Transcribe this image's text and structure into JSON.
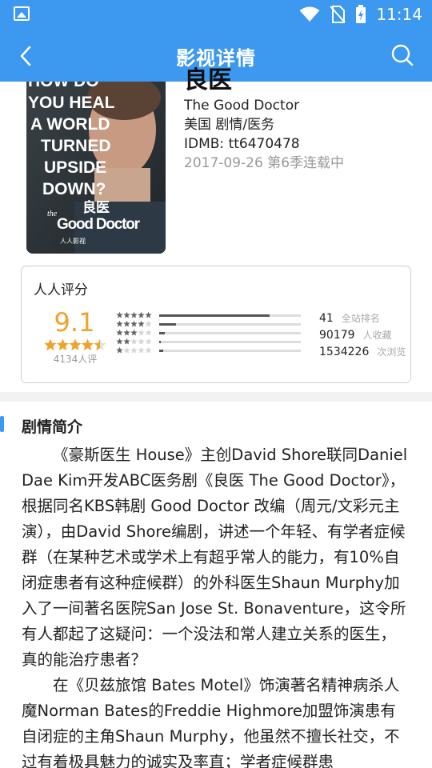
{
  "status_bar": {
    "time": "11:14"
  },
  "app_bar": {
    "title": "影视详情"
  },
  "poster": {
    "text_lines": [
      "HOW DO",
      "YOU HEAL",
      "A WORLD",
      "TURNED",
      "UPSIDE",
      "DOWN?"
    ],
    "title_cn": "良医",
    "title_en_the": "the",
    "title_en": "Good Doctor",
    "brand": "人人影视"
  },
  "show": {
    "name_cn": "良医",
    "name_en": "The Good Doctor",
    "region_genre": "美国 剧情/医务",
    "imdb": "IDMB: tt6470478",
    "date_status": "2017-09-26 第6季连载中"
  },
  "rating": {
    "label": "人人评分",
    "score": "9.1",
    "stars": 4.5,
    "count": "4134人评",
    "distribution": [
      0.78,
      0.12,
      0.04,
      0.01,
      0.03
    ],
    "stats": [
      {
        "value": "41",
        "label": "全站排名"
      },
      {
        "value": "90179",
        "label": "人收藏"
      },
      {
        "value": "1534226",
        "label": "次浏览"
      }
    ],
    "colors": {
      "accent": "#f0a329",
      "bar_fill": "#555555",
      "bar_track": "#dddddd"
    }
  },
  "synopsis": {
    "title": "剧情简介",
    "paragraphs": [
      "《豪斯医生 House》主创David Shore联同Daniel Dae Kim开发ABC医务剧《良医 The Good Doctor》，根据同名KBS韩剧 Good Doctor 改编（周元/文彩元主演），由David Shore编剧，讲述一个年轻、有学者症候群（在某种艺术或学术上有超乎常人的能力，有10%自闭症患者有这种症候群）的外科医生Shaun Murphy加入了一间著名医院San Jose St. Bonaventure，这令所有人都起了这疑问：一个没法和常人建立关系的医生，真的能治疗患者？",
      "在《贝兹旅馆 Bates Motel》饰演著名精神病杀人魔Norman Bates的Freddie Highmore加盟饰演患有自闭症的主角Shaun Murphy，他虽然不擅长社交，不过有着极具魅力的诚实及率直；学者症候群患"
    ]
  },
  "theme": {
    "primary": "#3d98ef"
  }
}
